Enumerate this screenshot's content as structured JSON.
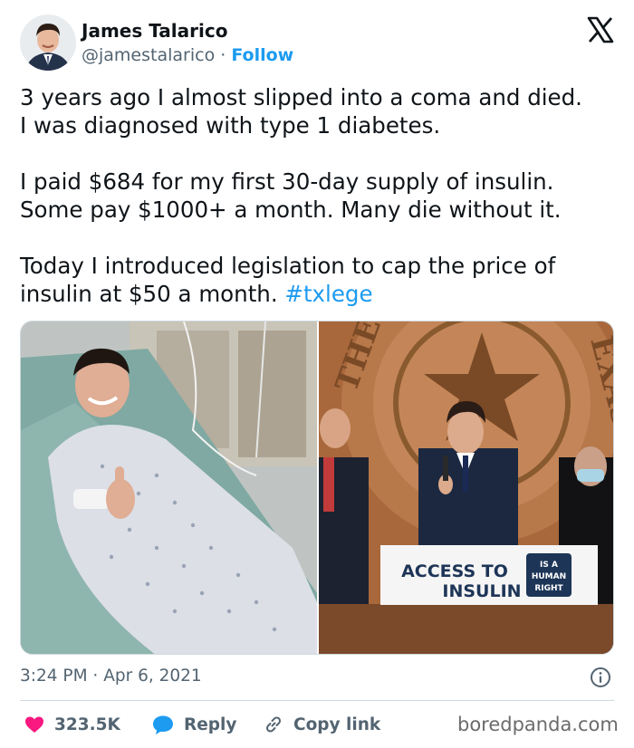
{
  "author": {
    "name": "James Talarico",
    "handle": "@jamestalarico",
    "separator": " · ",
    "follow_label": "Follow"
  },
  "tweet": {
    "paragraphs": [
      [
        "3 years ago I almost slipped into a coma and died.",
        "I was diagnosed with type 1 diabetes."
      ],
      [
        "I paid $684 for my first 30-day supply of insulin.",
        "Some pay $1000+ a month. Many die without it."
      ],
      [
        "Today I introduced legislation to cap the price of",
        "insulin at $50 a month. "
      ]
    ],
    "hashtag": "#txlege"
  },
  "media": {
    "sign": {
      "line1": "ACCESS TO",
      "line2": "INSULIN",
      "badge1": "IS A",
      "badge2": "HUMAN",
      "badge3": "RIGHT"
    },
    "seal_letters_left": "THE",
    "seal_letters_right": "EXAS"
  },
  "meta": {
    "time": "3:24 PM",
    "separator": " · ",
    "date": "Apr 6, 2021"
  },
  "actions": {
    "likes": "323.5K",
    "reply_label": "Reply",
    "copy_label": "Copy link"
  },
  "watermark": "boredpanda.com",
  "colors": {
    "accent": "#1d9bf0",
    "like": "#f91880",
    "secondary_text": "#536471"
  },
  "icons": [
    "x-logo-icon",
    "info-icon",
    "heart-icon",
    "reply-bubble-icon",
    "link-icon"
  ]
}
